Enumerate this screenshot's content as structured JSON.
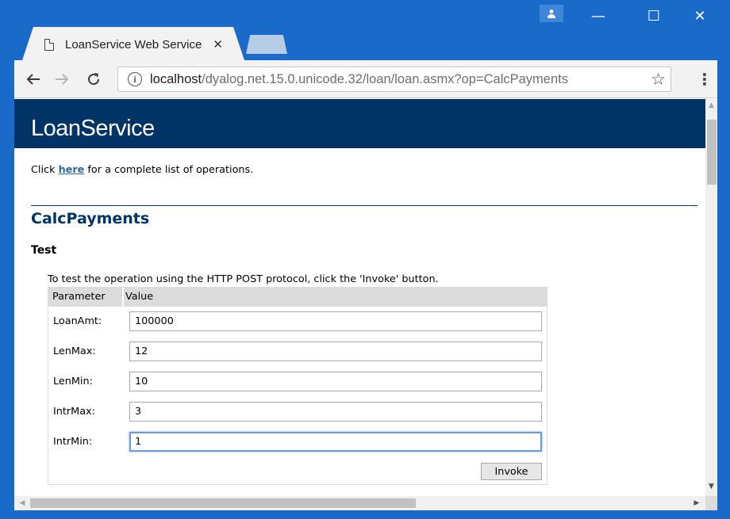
{
  "browser": {
    "tab_title": "LoanService Web Service",
    "tab_close": "✕",
    "url_host": "localhost",
    "url_path": "/dyalog.net.15.0.unicode.32/loan/loan.asmx?op=CalcPayments",
    "icons": {
      "back": "arrow-left-icon",
      "forward": "arrow-right-icon",
      "reload": "reload-icon",
      "info": "info-icon",
      "bookmark": "star-icon",
      "menu": "kebab-menu-icon"
    }
  },
  "window": {
    "minimize": "—",
    "maximize": "☐",
    "close": "✕"
  },
  "page": {
    "banner_title": "LoanService",
    "intro_before": "Click ",
    "intro_link": "here",
    "intro_after": " for a complete list of operations.",
    "operation_title": "CalcPayments",
    "test_heading": "Test",
    "test_description": "To test the operation using the HTTP POST protocol, click the 'Invoke' button.",
    "table_headers": [
      "Parameter",
      "Value"
    ],
    "parameters": [
      {
        "label": "LoanAmt:",
        "value": "100000"
      },
      {
        "label": "LenMax:",
        "value": "12"
      },
      {
        "label": "LenMin:",
        "value": "10"
      },
      {
        "label": "IntrMax:",
        "value": "3"
      },
      {
        "label": "IntrMin:",
        "value": "1"
      }
    ],
    "invoke_label": "Invoke"
  },
  "colors": {
    "titlebar": "#1a6bc9",
    "banner": "#003366",
    "link": "#336699"
  }
}
